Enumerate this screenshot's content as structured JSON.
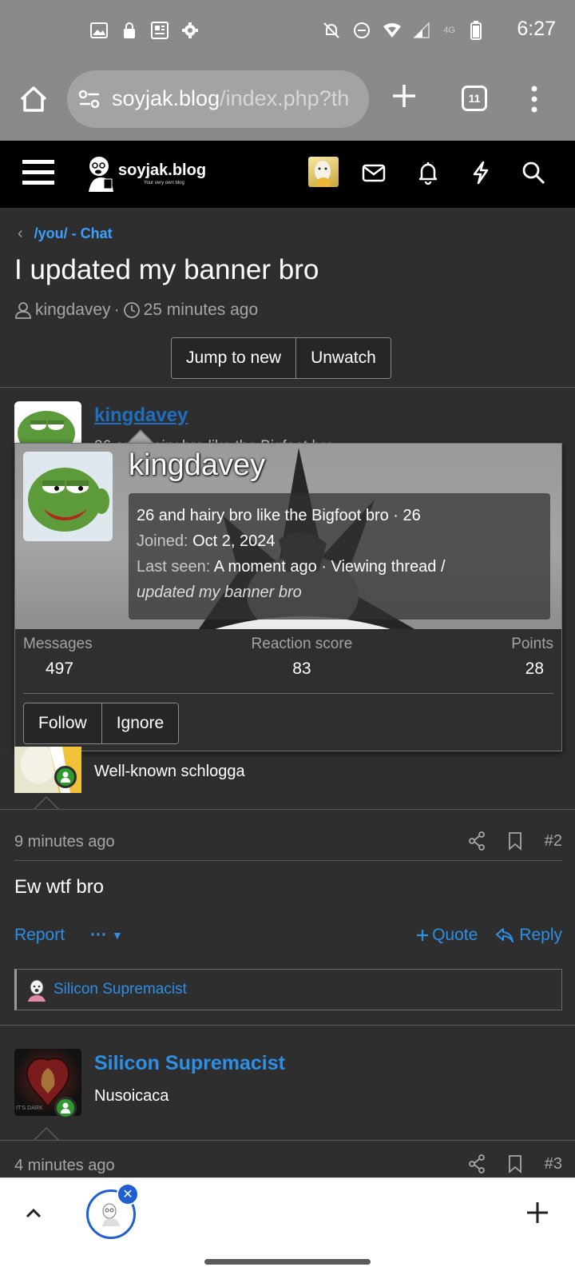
{
  "status_bar": {
    "time": "6:27",
    "network": "4G",
    "icons_left": [
      "image-icon",
      "lock-icon",
      "news-icon",
      "settings-icon"
    ],
    "icons_right": [
      "mute-icon",
      "dnd-icon",
      "wifi-icon",
      "signal-icon",
      "battery-icon"
    ]
  },
  "browser": {
    "url_host": "soyjak.blog",
    "url_path": "/index.php?th",
    "tab_count": "11"
  },
  "site": {
    "logo_text": "soyjak.blog",
    "logo_tagline": "Your very own blog"
  },
  "breadcrumb": {
    "label": "/you/ - Chat"
  },
  "thread": {
    "title": "I updated my banner bro",
    "author": "kingdavey",
    "time": "25 minutes ago",
    "jump_label": "Jump to new",
    "unwatch_label": "Unwatch"
  },
  "post1": {
    "author": "kingdavey",
    "subtitle": "26 and hairy bro like the Bigfoot bro"
  },
  "tooltip": {
    "name": "kingdavey",
    "blurb": "26 and hairy bro like the Bigfoot bro · 26",
    "joined_label": "Joined:",
    "joined_value": "Oct 2, 2024",
    "last_seen_label": "Last seen:",
    "last_seen_value": "A moment ago · Viewing thread /",
    "last_seen_thread": "updated my banner bro",
    "stats": [
      {
        "label": "Messages",
        "value": "497"
      },
      {
        "label": "Reaction score",
        "value": "83"
      },
      {
        "label": "Points",
        "value": "28"
      }
    ],
    "follow_label": "Follow",
    "ignore_label": "Ignore"
  },
  "post2": {
    "user_title": "Well-known schlogga",
    "time": "9 minutes ago",
    "number": "#2",
    "body": "Ew wtf bro",
    "report_label": "Report",
    "more_label": "···",
    "quote_label": "Quote",
    "reply_label": "Reply",
    "reaction_user": "Silicon Supremacist"
  },
  "post3": {
    "author": "Silicon Supremacist",
    "user_title": "Nusoicaca",
    "avatar_text": "IT'S DARK",
    "time": "4 minutes ago",
    "number": "#3"
  },
  "colors": {
    "accent": "#2d8fe6",
    "background": "#2e2e2e",
    "header": "#000000",
    "chrome": "#8a8a8a",
    "online": "#2d9a2d"
  }
}
